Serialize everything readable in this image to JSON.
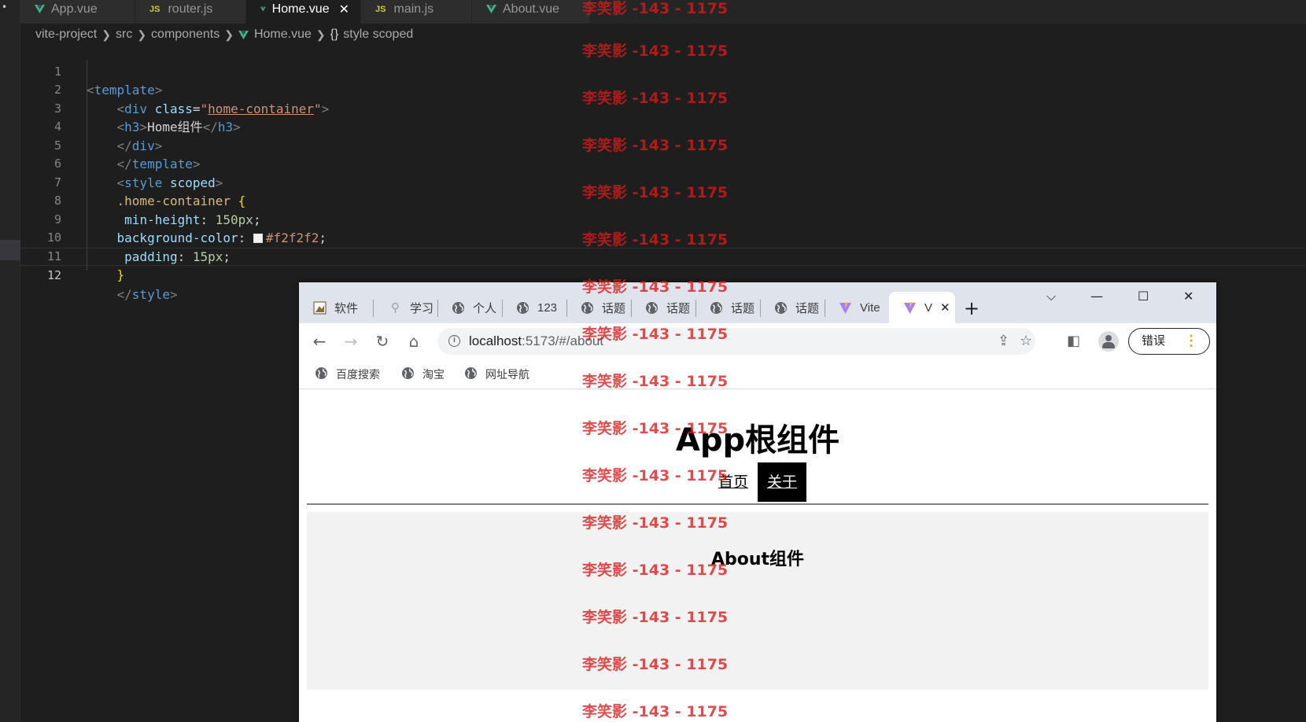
{
  "editor": {
    "tabs": [
      {
        "label": "App.vue",
        "type": "vue"
      },
      {
        "label": "router.js",
        "type": "js"
      },
      {
        "label": "Home.vue",
        "type": "vue",
        "active": true
      },
      {
        "label": "main.js",
        "type": "js"
      },
      {
        "label": "About.vue",
        "type": "vue"
      }
    ],
    "js_badge": "JS",
    "breadcrumb": [
      "vite-project",
      "src",
      "components",
      "Home.vue",
      "style scoped"
    ],
    "breadcrumb_braces": "{}",
    "line_numbers": [
      "1",
      "2",
      "3",
      "4",
      "5",
      "6",
      "7",
      "8",
      "9",
      "10",
      "11",
      "12"
    ],
    "code": {
      "l1_tag": "template",
      "l2_tag": "div",
      "l2_attr": "class",
      "l2_val": "home-container",
      "l3_tag": "h3",
      "l3_text": "Home组件",
      "l4_tag": "div",
      "l5_tag": "template",
      "l6_tag": "style",
      "l6_attr": "scoped",
      "l7_sel": ".home-container",
      "l8_prop": "min-height",
      "l8_val": "150px",
      "l9_prop": "background-color",
      "l9_val": "#f2f2f2",
      "l10_prop": "padding",
      "l10_val": "15px",
      "l12_tag": "style"
    },
    "colors": {
      "swatch": "#f2f2f2",
      "vue": "#41b883",
      "js": "#cbcb41"
    }
  },
  "browser": {
    "tabs": [
      "软件",
      "学习",
      "个人",
      "123",
      "话题",
      "话题",
      "话题",
      "话题",
      "Vite",
      "V"
    ],
    "new_tab": "+",
    "window_controls": {
      "chevron": "⌵",
      "minimize": "—",
      "maximize": "☐",
      "close": "✕"
    },
    "url_host": "localhost",
    "url_rest": ":5173/#/about",
    "error_button": "错误",
    "bookmarks": [
      "百度搜索",
      "淘宝",
      "网址导航"
    ],
    "page": {
      "title": "App根组件",
      "nav": [
        {
          "label": "首页"
        },
        {
          "label": "关于",
          "active": true
        }
      ],
      "about_title": "About组件"
    }
  },
  "watermark": {
    "text": "李笑影 -143 - 1175",
    "color": "#d61c1c"
  }
}
